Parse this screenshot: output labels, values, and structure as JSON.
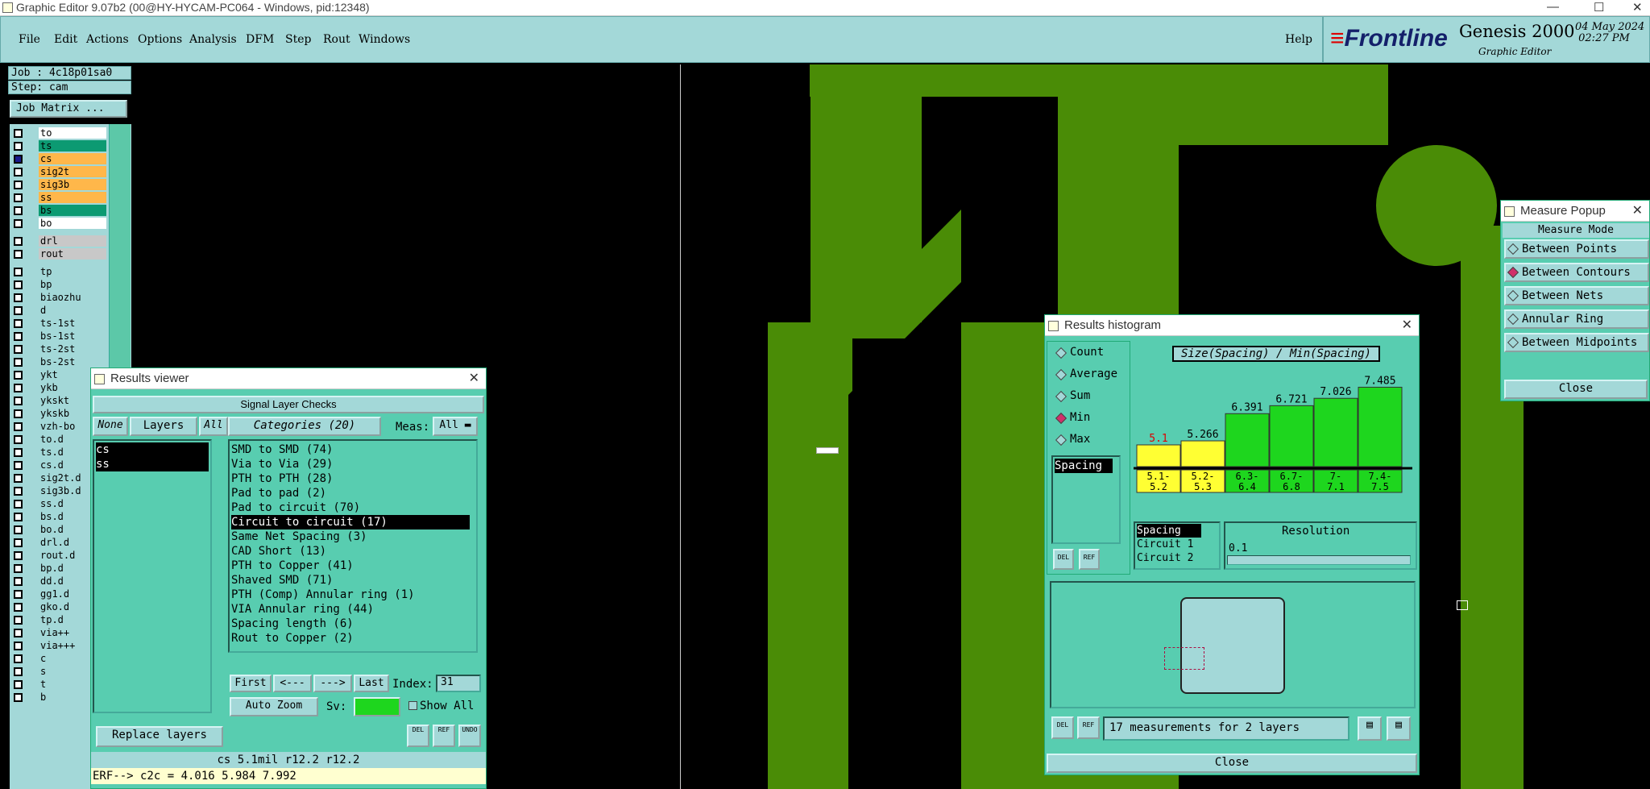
{
  "window_title": "Graphic Editor 9.07b2 (00@HY-HYCAM-PC064 - Windows, pid:12348)",
  "menu": [
    "File",
    "Edit",
    "Actions",
    "Options",
    "Analysis",
    "DFM",
    "Step",
    "Rout",
    "Windows"
  ],
  "help_label": "Help",
  "brand": {
    "logo": "Frontline",
    "product": "Genesis 2000",
    "subtitle": "Graphic Editor",
    "date": "04 May 2024",
    "time": "02:27 PM"
  },
  "job": {
    "job": "Job : 4c18p01sa0",
    "step": "Step: cam",
    "matrix_button": "Job Matrix ..."
  },
  "layers": [
    {
      "name": "to",
      "color": "#ffffff"
    },
    {
      "name": "ts",
      "color": "#0c9a72"
    },
    {
      "name": "cs",
      "color": "#ffb74a",
      "active": true
    },
    {
      "name": "sig2t",
      "color": "#ffb74a"
    },
    {
      "name": "sig3b",
      "color": "#ffb74a"
    },
    {
      "name": "ss",
      "color": "#ffb74a"
    },
    {
      "name": "bs",
      "color": "#0c9a72"
    },
    {
      "name": "bo",
      "color": "#ffffff"
    },
    {
      "name": "drl",
      "color": "#c8c8c8"
    },
    {
      "name": "rout",
      "color": "#c8c8c8"
    },
    {
      "name": "tp",
      "color": "#a3d8d8"
    },
    {
      "name": "bp",
      "color": "#a3d8d8"
    },
    {
      "name": "biaozhu",
      "color": "#a3d8d8"
    },
    {
      "name": "d",
      "color": "#a3d8d8"
    },
    {
      "name": "ts-1st",
      "color": "#a3d8d8"
    },
    {
      "name": "bs-1st",
      "color": "#a3d8d8"
    },
    {
      "name": "ts-2st",
      "color": "#a3d8d8"
    },
    {
      "name": "bs-2st",
      "color": "#a3d8d8"
    },
    {
      "name": "ykt",
      "color": "#a3d8d8"
    },
    {
      "name": "ykb",
      "color": "#a3d8d8"
    },
    {
      "name": "ykskt",
      "color": "#a3d8d8"
    },
    {
      "name": "ykskb",
      "color": "#a3d8d8"
    },
    {
      "name": "vzh-bo",
      "color": "#a3d8d8"
    },
    {
      "name": "to.d",
      "color": "#a3d8d8"
    },
    {
      "name": "ts.d",
      "color": "#a3d8d8"
    },
    {
      "name": "cs.d",
      "color": "#a3d8d8"
    },
    {
      "name": "sig2t.d",
      "color": "#a3d8d8"
    },
    {
      "name": "sig3b.d",
      "color": "#a3d8d8"
    },
    {
      "name": "ss.d",
      "color": "#a3d8d8"
    },
    {
      "name": "bs.d",
      "color": "#a3d8d8"
    },
    {
      "name": "bo.d",
      "color": "#a3d8d8"
    },
    {
      "name": "drl.d",
      "color": "#a3d8d8"
    },
    {
      "name": "rout.d",
      "color": "#a3d8d8"
    },
    {
      "name": "bp.d",
      "color": "#a3d8d8"
    },
    {
      "name": "dd.d",
      "color": "#a3d8d8"
    },
    {
      "name": "gg1.d",
      "color": "#a3d8d8"
    },
    {
      "name": "gko.d",
      "color": "#a3d8d8"
    },
    {
      "name": "tp.d",
      "color": "#a3d8d8"
    },
    {
      "name": "via++",
      "color": "#a3d8d8"
    },
    {
      "name": "via+++",
      "color": "#a3d8d8"
    },
    {
      "name": "c",
      "color": "#a3d8d8"
    },
    {
      "name": "s",
      "color": "#a3d8d8"
    },
    {
      "name": "t",
      "color": "#a3d8d8"
    },
    {
      "name": "b",
      "color": "#a3d8d8"
    }
  ],
  "results_viewer": {
    "title": "Results viewer",
    "section": "Signal Layer Checks",
    "none": "None",
    "layers": "Layers",
    "all": "All",
    "categories_btn": "Categories (20)",
    "meas_label": "Meas:",
    "meas_value": "All",
    "layer_items": [
      "cs",
      "ss"
    ],
    "categories": [
      "SMD to SMD (74)",
      "Via to Via (29)",
      "PTH to PTH (28)",
      "Pad to pad (2)",
      "Pad to circuit (70)",
      "Circuit to circuit (17)",
      "Same Net Spacing (3)",
      "CAD Short (13)",
      "PTH to Copper (41)",
      "Shaved SMD (71)",
      "PTH (Comp) Annular ring (1)",
      "VIA Annular ring (44)",
      "Spacing length (6)",
      "Rout to Copper (2)"
    ],
    "selected_category": "Circuit to circuit (17)",
    "first": "First",
    "prev": "<---",
    "next": "--->",
    "last": "Last",
    "index_label": "Index:",
    "index_value": "31",
    "auto_zoom": "Auto Zoom",
    "sv": "Sv:",
    "show_all": "Show All",
    "replace_layers": "Replace layers",
    "status1": "cs 5.1mil  r12.2  r12.2",
    "status2": "ERF--> c2c = 4.016 5.984 7.992",
    "del": "DEL",
    "ref": "REF",
    "undo": "UNDO"
  },
  "histogram": {
    "title": "Results histogram",
    "options": [
      "Count",
      "Average",
      "Sum",
      "Min",
      "Max"
    ],
    "selected_option": "Min",
    "chart_title": "Size(Spacing) / Min(Spacing)",
    "list_item": "Spacing",
    "params": [
      "Spacing",
      "Circuit 1",
      "Circuit 2"
    ],
    "resolution_label": "Resolution",
    "resolution_value": "0.1",
    "summary": "17 measurements for 2 layers",
    "close": "Close",
    "del": "DEL",
    "ref": "REF"
  },
  "chart_data": {
    "type": "bar",
    "title": "Size(Spacing) / Min(Spacing)",
    "categories": [
      "5.1-\n5.2",
      "5.2-\n5.3",
      "6.3-\n6.4",
      "6.7-\n6.8",
      "7-\n7.1",
      "7.4-\n7.5"
    ],
    "values": [
      5.1,
      5.266,
      6.391,
      6.721,
      7.026,
      7.485
    ],
    "value_labels": [
      "5.1",
      "5.266",
      "6.391",
      "6.721",
      "7.026",
      "7.485"
    ],
    "colors": [
      "#ffff33",
      "#ffff33",
      "#1ed61e",
      "#1ed61e",
      "#1ed61e",
      "#1ed61e"
    ],
    "label_colors": [
      "#d00",
      "#000",
      "#000",
      "#000",
      "#000",
      "#000"
    ],
    "ylim": [
      4.2,
      7.6
    ]
  },
  "measure": {
    "title": "Measure Popup",
    "mode": "Measure Mode",
    "options": [
      "Between Points",
      "Between Contours",
      "Between Nets",
      "Annular Ring",
      "Between Midpoints"
    ],
    "selected": "Between Contours",
    "close": "Close"
  }
}
